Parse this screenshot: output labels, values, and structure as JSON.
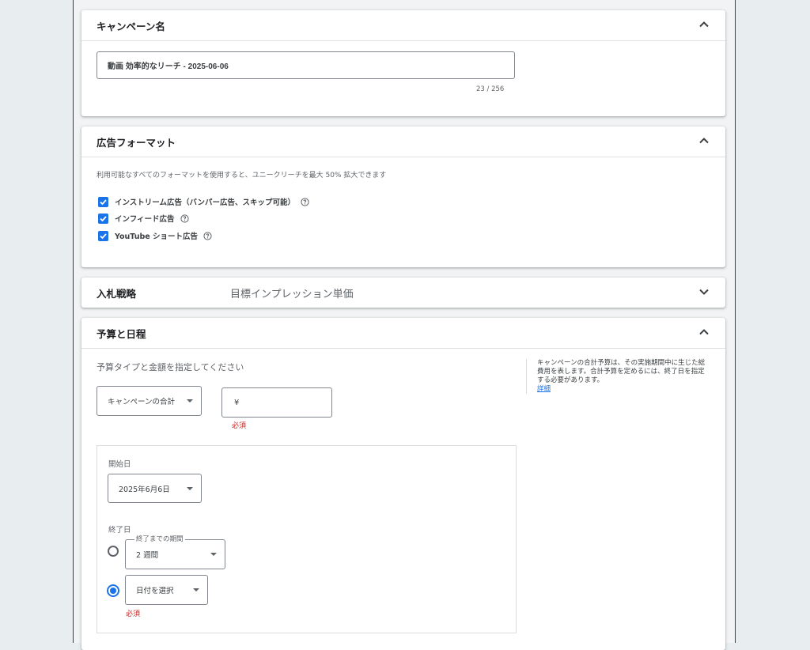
{
  "campaign_name": {
    "title": "キャンペーン名",
    "value": "動画 効率的なリーチ - 2025-06-06",
    "counter": "23 / 256"
  },
  "ad_format": {
    "title": "広告フォーマット",
    "description": "利用可能なすべてのフォーマットを使用すると、ユニークリーチを最大 50% 拡大できます",
    "options": [
      {
        "label": "インストリーム広告（バンパー広告、スキップ可能）",
        "checked": true
      },
      {
        "label": "インフィード広告",
        "checked": true
      },
      {
        "label": "YouTube ショート広告",
        "checked": true
      }
    ]
  },
  "bidding": {
    "title": "入札戦略",
    "value": "目標インプレッション単価"
  },
  "budget_schedule": {
    "title": "予算と日程",
    "subtitle": "予算タイプと金額を指定してください",
    "budget_type": "キャンペーンの合計",
    "currency": "¥",
    "amount_required": "必須",
    "info_text": "キャンペーンの合計予算は、その実施期間中に生じた総費用を表します。合計予算を定めるには、終了日を指定する必要があります。",
    "info_link": "詳細",
    "start_label": "開始日",
    "start_date": "2025年6月6日",
    "end_label": "終了日",
    "duration_legend": "終了までの期間",
    "duration_value": "2 週間",
    "date_select": "日付を選択",
    "date_required": "必須"
  },
  "colors": {
    "accent": "#1a73e8",
    "error": "#c5221f"
  }
}
